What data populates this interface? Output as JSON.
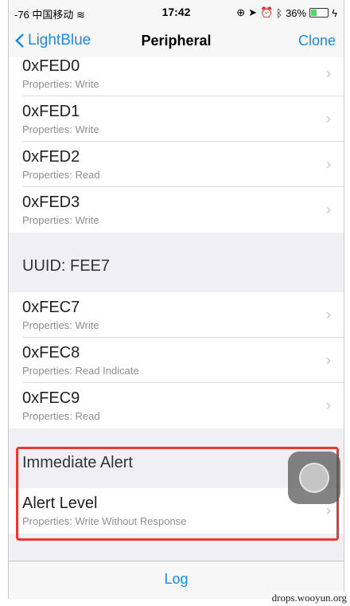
{
  "status": {
    "signal": "-76",
    "carrier": "中国移动",
    "time": "17:42",
    "battery": "36%",
    "battery_level": 0.36
  },
  "nav": {
    "back": "LightBlue",
    "title": "Peripheral",
    "right": "Clone"
  },
  "sections": [
    {
      "title": "",
      "rows": [
        {
          "uuid": "0xFED0",
          "props": "Properties: Write"
        },
        {
          "uuid": "0xFED1",
          "props": "Properties: Write"
        },
        {
          "uuid": "0xFED2",
          "props": "Properties: Read"
        },
        {
          "uuid": "0xFED3",
          "props": "Properties: Write"
        }
      ]
    },
    {
      "title": "UUID: FEE7",
      "rows": [
        {
          "uuid": "0xFEC7",
          "props": "Properties: Write"
        },
        {
          "uuid": "0xFEC8",
          "props": "Properties: Read Indicate"
        },
        {
          "uuid": "0xFEC9",
          "props": "Properties: Read"
        }
      ]
    },
    {
      "title": "Immediate Alert",
      "rows": [
        {
          "uuid": "Alert Level",
          "props": "Properties: Write Without Response"
        }
      ]
    }
  ],
  "tabbar": {
    "label": "Log"
  },
  "watermark": "drops.wooyun.org",
  "icons": {
    "chevron": "chevron-right-icon",
    "back": "chevron-left-icon"
  }
}
